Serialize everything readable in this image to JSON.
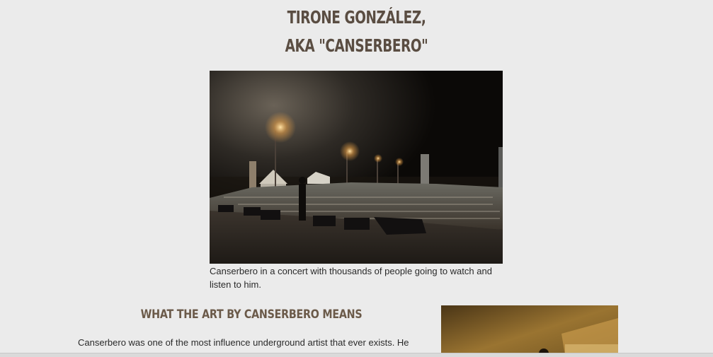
{
  "header": {
    "title_line1": "TIRONE GONZÁLEZ,",
    "title_line2": "AKA \"CANSERBERO\""
  },
  "hero": {
    "caption": "Canserbero in a concert with thousands of people going to watch and listen to him."
  },
  "section": {
    "heading": "WHAT THE ART BY CANSERBERO MEANS",
    "body": "Canserbero was one of the most influence underground artist that ever exists. He contributed to the well-being of his fans with music and protest songs. \"All"
  },
  "colors": {
    "background": "#ebebeb",
    "title": "#5a4d42",
    "heading": "#6b5a49",
    "text": "#2a2a2a"
  }
}
